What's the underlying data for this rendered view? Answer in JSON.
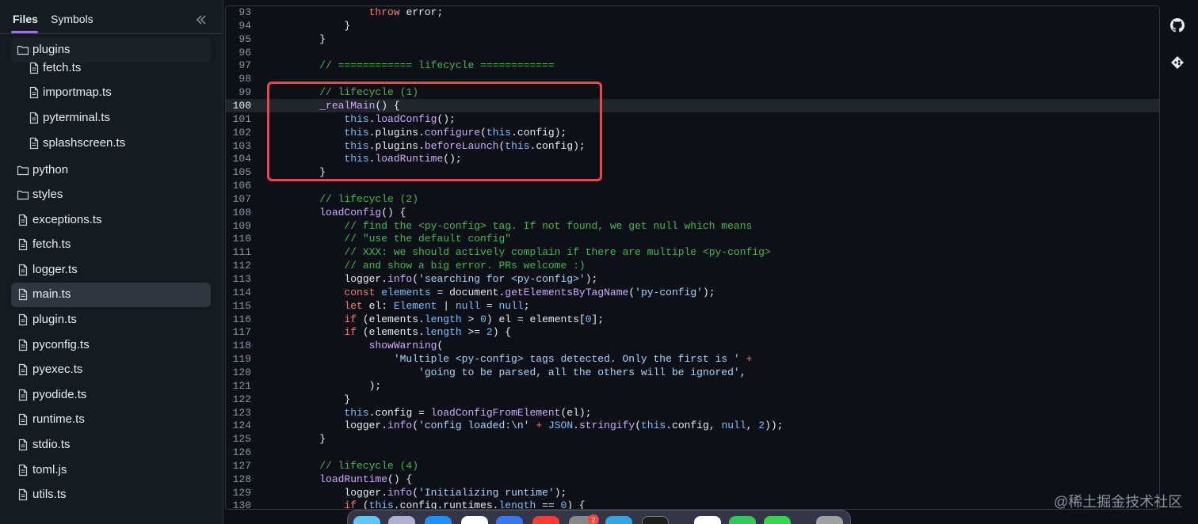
{
  "sidebar": {
    "tabs": {
      "files": "Files",
      "symbols": "Symbols"
    },
    "items": [
      {
        "label": "plugins",
        "type": "folder"
      },
      {
        "label": "fetch.ts",
        "type": "file"
      },
      {
        "label": "importmap.ts",
        "type": "file"
      },
      {
        "label": "pyterminal.ts",
        "type": "file"
      },
      {
        "label": "splashscreen.ts",
        "type": "file"
      },
      {
        "label": "python",
        "type": "folder"
      },
      {
        "label": "styles",
        "type": "folder"
      },
      {
        "label": "exceptions.ts",
        "type": "file"
      },
      {
        "label": "fetch.ts",
        "type": "file"
      },
      {
        "label": "logger.ts",
        "type": "file"
      },
      {
        "label": "main.ts",
        "type": "file",
        "active": true
      },
      {
        "label": "plugin.ts",
        "type": "file"
      },
      {
        "label": "pyconfig.ts",
        "type": "file"
      },
      {
        "label": "pyexec.ts",
        "type": "file"
      },
      {
        "label": "pyodide.ts",
        "type": "file"
      },
      {
        "label": "runtime.ts",
        "type": "file"
      },
      {
        "label": "stdio.ts",
        "type": "file"
      },
      {
        "label": "toml.js",
        "type": "file"
      },
      {
        "label": "utils.ts",
        "type": "file"
      }
    ]
  },
  "editor": {
    "highlighted_line": 100,
    "lines": [
      {
        "n": "93",
        "tokens": [
          [
            "",
            "            "
          ],
          [
            "kw",
            "throw"
          ],
          [
            "",
            " error;"
          ]
        ]
      },
      {
        "n": "94",
        "tokens": [
          [
            "",
            "        }"
          ]
        ]
      },
      {
        "n": "95",
        "tokens": [
          [
            "",
            "    }"
          ]
        ]
      },
      {
        "n": "96",
        "tokens": []
      },
      {
        "n": "97",
        "tokens": [
          [
            "",
            "    "
          ],
          [
            "com",
            "// ============ lifecycle ============"
          ]
        ]
      },
      {
        "n": "98",
        "tokens": []
      },
      {
        "n": "99",
        "tokens": [
          [
            "",
            "    "
          ],
          [
            "com",
            "// lifecycle (1)"
          ]
        ]
      },
      {
        "n": "100",
        "tokens": [
          [
            "",
            "    "
          ],
          [
            "fn",
            "_realMain"
          ],
          [
            "",
            "() {"
          ]
        ]
      },
      {
        "n": "101",
        "tokens": [
          [
            "",
            "        "
          ],
          [
            "var",
            "this"
          ],
          [
            "",
            "."
          ],
          [
            "fn",
            "loadConfig"
          ],
          [
            "",
            "();"
          ]
        ]
      },
      {
        "n": "102",
        "tokens": [
          [
            "",
            "        "
          ],
          [
            "var",
            "this"
          ],
          [
            "",
            ".plugins."
          ],
          [
            "fn",
            "configure"
          ],
          [
            "",
            "("
          ],
          [
            "var",
            "this"
          ],
          [
            "",
            ".config);"
          ]
        ]
      },
      {
        "n": "103",
        "tokens": [
          [
            "",
            "        "
          ],
          [
            "var",
            "this"
          ],
          [
            "",
            ".plugins."
          ],
          [
            "fn",
            "beforeLaunch"
          ],
          [
            "",
            "("
          ],
          [
            "var",
            "this"
          ],
          [
            "",
            ".config);"
          ]
        ]
      },
      {
        "n": "104",
        "tokens": [
          [
            "",
            "        "
          ],
          [
            "var",
            "this"
          ],
          [
            "",
            "."
          ],
          [
            "fn",
            "loadRuntime"
          ],
          [
            "",
            "();"
          ]
        ]
      },
      {
        "n": "105",
        "tokens": [
          [
            "",
            "    }"
          ]
        ]
      },
      {
        "n": "106",
        "tokens": []
      },
      {
        "n": "107",
        "tokens": [
          [
            "",
            "    "
          ],
          [
            "com",
            "// lifecycle (2)"
          ]
        ]
      },
      {
        "n": "108",
        "tokens": [
          [
            "",
            "    "
          ],
          [
            "fn",
            "loadConfig"
          ],
          [
            "",
            "() {"
          ]
        ]
      },
      {
        "n": "109",
        "tokens": [
          [
            "",
            "        "
          ],
          [
            "com",
            "// find the <py-config> tag. If not found, we get null which means"
          ]
        ]
      },
      {
        "n": "110",
        "tokens": [
          [
            "",
            "        "
          ],
          [
            "com",
            "// \"use the default config\""
          ]
        ]
      },
      {
        "n": "111",
        "tokens": [
          [
            "",
            "        "
          ],
          [
            "com",
            "// XXX: we should actively complain if there are multiple <py-config>"
          ]
        ]
      },
      {
        "n": "112",
        "tokens": [
          [
            "",
            "        "
          ],
          [
            "com",
            "// and show a big error. PRs welcome :)"
          ]
        ]
      },
      {
        "n": "113",
        "tokens": [
          [
            "",
            "        logger."
          ],
          [
            "fn",
            "info"
          ],
          [
            "",
            "("
          ],
          [
            "str",
            "'searching for <py-config>'"
          ],
          [
            "",
            ");"
          ]
        ]
      },
      {
        "n": "114",
        "tokens": [
          [
            "",
            "        "
          ],
          [
            "kw",
            "const"
          ],
          [
            "",
            " "
          ],
          [
            "var",
            "elements"
          ],
          [
            "",
            " = document."
          ],
          [
            "fn",
            "getElementsByTagName"
          ],
          [
            "",
            "("
          ],
          [
            "str",
            "'py-config'"
          ],
          [
            "",
            ");"
          ]
        ]
      },
      {
        "n": "115",
        "tokens": [
          [
            "",
            "        "
          ],
          [
            "kw",
            "let"
          ],
          [
            "",
            " el: "
          ],
          [
            "bl",
            "Element"
          ],
          [
            "",
            " | "
          ],
          [
            "bl",
            "null"
          ],
          [
            "",
            " = "
          ],
          [
            "bl",
            "null"
          ],
          [
            "",
            ";"
          ]
        ]
      },
      {
        "n": "116",
        "tokens": [
          [
            "",
            "        "
          ],
          [
            "kw",
            "if"
          ],
          [
            "",
            " (elements."
          ],
          [
            "var",
            "length"
          ],
          [
            "",
            " > "
          ],
          [
            "num",
            "0"
          ],
          [
            "",
            ") el = elements["
          ],
          [
            "num",
            "0"
          ],
          [
            "",
            "];"
          ]
        ]
      },
      {
        "n": "117",
        "tokens": [
          [
            "",
            "        "
          ],
          [
            "kw",
            "if"
          ],
          [
            "",
            " (elements."
          ],
          [
            "var",
            "length"
          ],
          [
            "",
            " >= "
          ],
          [
            "num",
            "2"
          ],
          [
            "",
            ") {"
          ]
        ]
      },
      {
        "n": "118",
        "tokens": [
          [
            "",
            "            "
          ],
          [
            "fn",
            "showWarning"
          ],
          [
            "",
            "("
          ]
        ]
      },
      {
        "n": "119",
        "tokens": [
          [
            "",
            "                "
          ],
          [
            "str",
            "'Multiple <py-config> tags detected. Only the first is '"
          ],
          [
            "",
            " "
          ],
          [
            "kw",
            "+"
          ]
        ]
      },
      {
        "n": "120",
        "tokens": [
          [
            "",
            "                    "
          ],
          [
            "str",
            "'going to be parsed, all the others will be ignored'"
          ],
          [
            "",
            ","
          ]
        ]
      },
      {
        "n": "121",
        "tokens": [
          [
            "",
            "            );"
          ]
        ]
      },
      {
        "n": "122",
        "tokens": [
          [
            "",
            "        }"
          ]
        ]
      },
      {
        "n": "123",
        "tokens": [
          [
            "",
            "        "
          ],
          [
            "var",
            "this"
          ],
          [
            "",
            ".config = "
          ],
          [
            "fn",
            "loadConfigFromElement"
          ],
          [
            "",
            "(el);"
          ]
        ]
      },
      {
        "n": "124",
        "tokens": [
          [
            "",
            "        logger."
          ],
          [
            "fn",
            "info"
          ],
          [
            "",
            "("
          ],
          [
            "str",
            "'config loaded:\\n'"
          ],
          [
            "",
            " "
          ],
          [
            "kw",
            "+"
          ],
          [
            "",
            " "
          ],
          [
            "var",
            "JSON"
          ],
          [
            "",
            "."
          ],
          [
            "fn",
            "stringify"
          ],
          [
            "",
            "("
          ],
          [
            "var",
            "this"
          ],
          [
            "",
            ".config, "
          ],
          [
            "bl",
            "null"
          ],
          [
            "",
            ", "
          ],
          [
            "num",
            "2"
          ],
          [
            "",
            "));"
          ]
        ]
      },
      {
        "n": "125",
        "tokens": [
          [
            "",
            "    }"
          ]
        ]
      },
      {
        "n": "126",
        "tokens": []
      },
      {
        "n": "127",
        "tokens": [
          [
            "",
            "    "
          ],
          [
            "com",
            "// lifecycle (4)"
          ]
        ]
      },
      {
        "n": "128",
        "tokens": [
          [
            "",
            "    "
          ],
          [
            "fn",
            "loadRuntime"
          ],
          [
            "",
            "() {"
          ]
        ]
      },
      {
        "n": "129",
        "tokens": [
          [
            "",
            "        logger."
          ],
          [
            "fn",
            "info"
          ],
          [
            "",
            "("
          ],
          [
            "str",
            "'Initializing runtime'"
          ],
          [
            "",
            ");"
          ]
        ]
      },
      {
        "n": "130",
        "tokens": [
          [
            "",
            "        "
          ],
          [
            "kw",
            "if"
          ],
          [
            "",
            " ("
          ],
          [
            "var",
            "this"
          ],
          [
            "",
            ".config.runtimes."
          ],
          [
            "var",
            "length"
          ],
          [
            "",
            " == "
          ],
          [
            "num",
            "0"
          ],
          [
            "",
            ") {"
          ]
        ]
      }
    ]
  },
  "rail": {
    "icons": [
      "github-icon",
      "git-icon"
    ]
  },
  "dock": {
    "badge": "2"
  },
  "watermark": "@稀土掘金技术社区",
  "colors": {
    "accent": "#a371f7",
    "highlight_box": "#e5484d"
  }
}
